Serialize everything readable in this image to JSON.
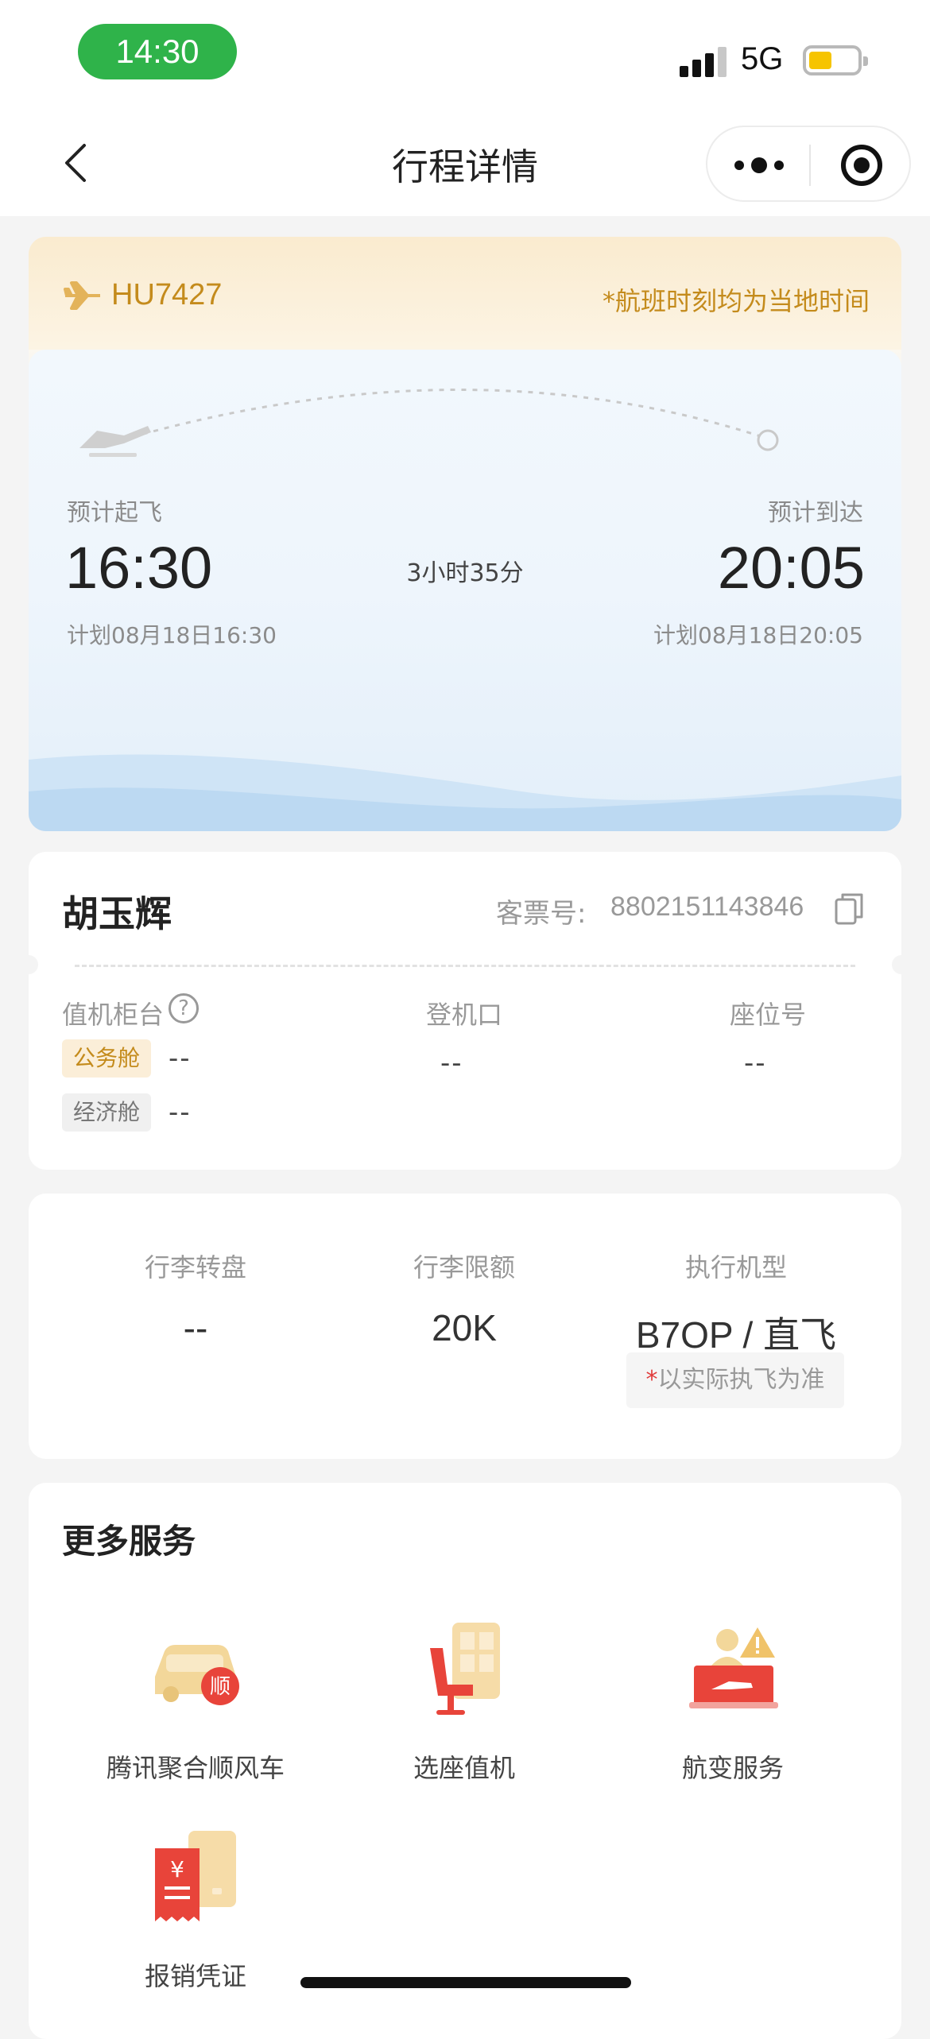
{
  "status_bar": {
    "time": "14:30",
    "network": "5G",
    "battery_level": 0.35,
    "signal_bars": 4
  },
  "nav": {
    "title": "行程详情",
    "back_icon": "chevron-left-icon",
    "more_icon": "more-dots-icon",
    "close_icon": "target-icon"
  },
  "flight": {
    "number": "HU7427",
    "local_time_note": "*航班时刻均为当地时间",
    "departure": {
      "label": "预计起飞",
      "time": "16:30",
      "planned": "计划08月18日16:30"
    },
    "arrival": {
      "label": "预计到达",
      "time": "20:05",
      "planned": "计划08月18日20:05"
    },
    "duration": "3小时35分"
  },
  "passenger": {
    "name": "胡玉辉",
    "ticket_label": "客票号:",
    "ticket_number": "8802151143846",
    "counter_label": "值机柜台",
    "gate_label": "登机口",
    "seat_label": "座位号",
    "business_tag": "公务舱",
    "economy_tag": "经济舱",
    "business_counter": "--",
    "economy_counter": "--",
    "gate": "--",
    "seat": "--"
  },
  "baggage": {
    "carousel_label": "行李转盘",
    "carousel_value": "--",
    "allowance_label": "行李限额",
    "allowance_value": "20K",
    "aircraft_label": "执行机型",
    "aircraft_value": "B7OP / 直飞",
    "aircraft_note_star": "*",
    "aircraft_note": "以实际执飞为准"
  },
  "services": {
    "title": "更多服务",
    "items": [
      {
        "label": "腾讯聚合顺风车",
        "icon": "car-ride-icon"
      },
      {
        "label": "选座值机",
        "icon": "seat-checkin-icon"
      },
      {
        "label": "航变服务",
        "icon": "flight-change-icon"
      },
      {
        "label": "报销凭证",
        "icon": "receipt-icon"
      }
    ]
  },
  "colors": {
    "accent_gold": "#c48b1c",
    "status_green": "#2fb34a",
    "service_red": "#e8443a"
  }
}
